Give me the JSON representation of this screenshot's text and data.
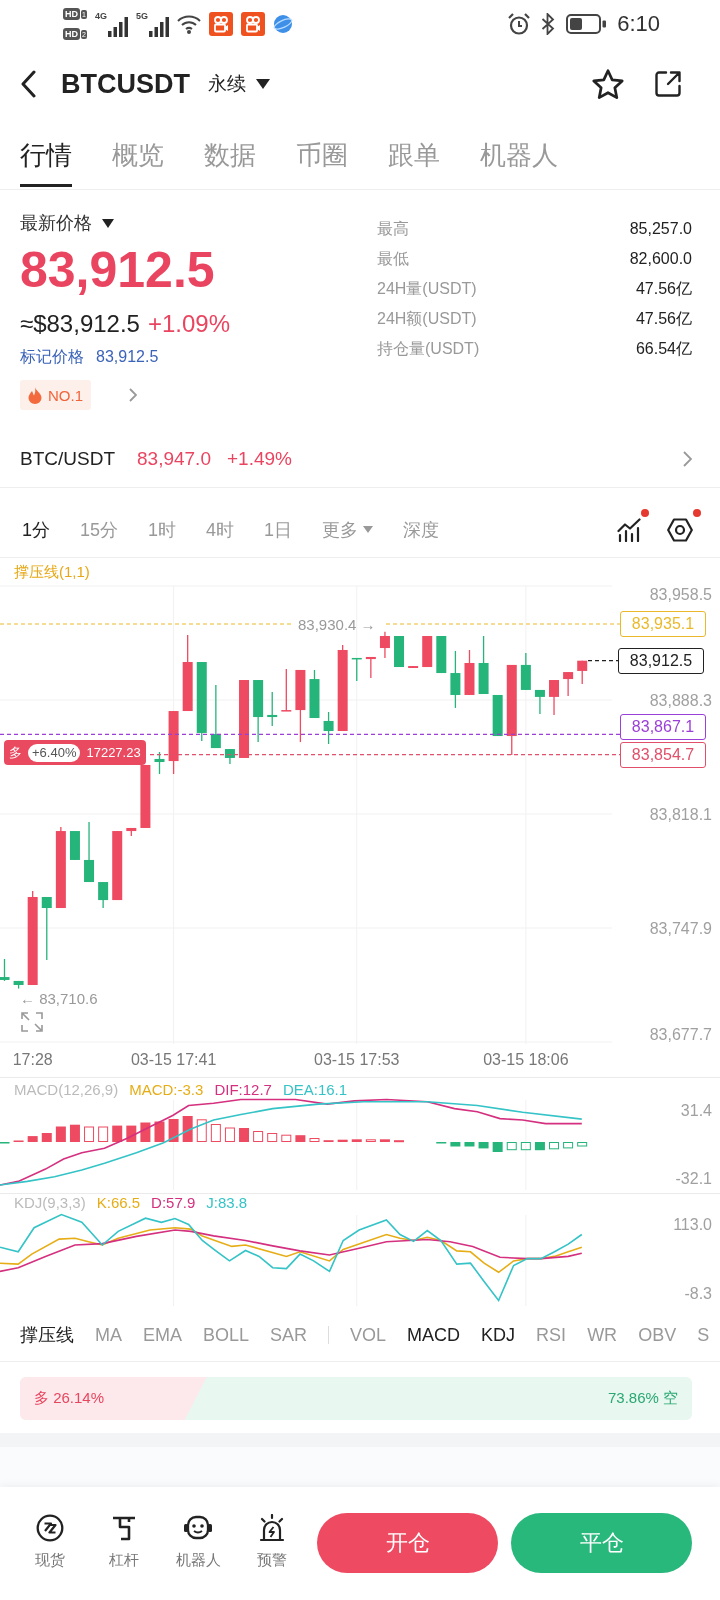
{
  "status_bar": {
    "sims": [
      {
        "badge": "HD",
        "slot": "1"
      },
      {
        "badge": "HD",
        "slot": "2"
      }
    ],
    "networks": [
      "4G",
      "5G"
    ],
    "time": "6:10"
  },
  "header": {
    "symbol": "BTCUSDT",
    "contract": "永续"
  },
  "tabs": [
    {
      "label": "行情",
      "selected": true
    },
    {
      "label": "概览",
      "selected": false
    },
    {
      "label": "数据",
      "selected": false
    },
    {
      "label": "币圈",
      "selected": false
    },
    {
      "label": "跟单",
      "selected": false
    },
    {
      "label": "机器人",
      "selected": false
    }
  ],
  "price": {
    "label": "最新价格",
    "last": "83,912.5",
    "usd": "≈$83,912.5",
    "change": "+1.09%",
    "mark_label": "标记价格",
    "mark": "83,912.5",
    "rank": "NO.1"
  },
  "stats": [
    {
      "label": "最高",
      "value": "85,257.0"
    },
    {
      "label": "最低",
      "value": "82,600.0"
    },
    {
      "label": "24H量(USDT)",
      "value": "47.56亿"
    },
    {
      "label": "24H额(USDT)",
      "value": "47.56亿"
    },
    {
      "label": "持仓量(USDT)",
      "value": "66.54亿"
    }
  ],
  "spot": {
    "pair": "BTC/USDT",
    "price": "83,947.0",
    "change": "+1.49%"
  },
  "timeframes": [
    {
      "label": "1分",
      "kind": "tab",
      "selected": true
    },
    {
      "label": "15分",
      "kind": "tab",
      "selected": false
    },
    {
      "label": "1时",
      "kind": "tab",
      "selected": false
    },
    {
      "label": "4时",
      "kind": "tab",
      "selected": false
    },
    {
      "label": "1日",
      "kind": "tab",
      "selected": false
    },
    {
      "label": "更多",
      "kind": "dropdown",
      "selected": false
    },
    {
      "label": "深度",
      "kind": "tab",
      "selected": false
    }
  ],
  "chart_tools": [
    {
      "kind": "indicators",
      "notice": true
    },
    {
      "kind": "settings",
      "notice": true
    }
  ],
  "chart": {
    "overlay": "撑压线(1,1)",
    "chart_data": {
      "type": "candlestick",
      "categories": [
        null,
        null,
        "17:28",
        null,
        null,
        null,
        null,
        null,
        null,
        null,
        null,
        null,
        "03-15 17:41",
        null,
        null,
        null,
        null,
        null,
        null,
        null,
        null,
        null,
        null,
        null,
        null,
        "03-15 17:53",
        null,
        null,
        null,
        null,
        null,
        null,
        null,
        null,
        null,
        null,
        null,
        "03-15 18:06",
        null,
        null,
        null,
        null
      ],
      "ohlc": [
        [
          83717.7,
          83728.8,
          83715.3,
          83715.9
        ],
        [
          83715.3,
          83715.3,
          83710.6,
          83712.8
        ],
        [
          83712.8,
          83770.7,
          83712.8,
          83767.0
        ],
        [
          83767.0,
          83767.0,
          83728.2,
          83760.2
        ],
        [
          83760.2,
          83810.1,
          83760.2,
          83807.6
        ],
        [
          83807.6,
          83807.6,
          83789.8,
          83789.8
        ],
        [
          83789.8,
          83813.2,
          83776.2,
          83776.2
        ],
        [
          83776.2,
          83776.2,
          83760.2,
          83765.1
        ],
        [
          83765.1,
          83807.6,
          83765.1,
          83807.6
        ],
        [
          83807.6,
          83809.5,
          83804.6,
          83809.5
        ],
        [
          83809.5,
          83848.3,
          83809.5,
          83848.3
        ],
        [
          83852.0,
          83856.3,
          83842.7,
          83850.1
        ],
        [
          83850.7,
          83881.5,
          83842.7,
          83881.5
        ],
        [
          83881.5,
          83928.3,
          83881.5,
          83911.7
        ],
        [
          83911.7,
          83911.7,
          83863.1,
          83868.0
        ],
        [
          83867.4,
          83897.5,
          83858.7,
          83858.7
        ],
        [
          83858.1,
          83858.1,
          83848.9,
          83852.6
        ],
        [
          83852.6,
          83900.6,
          83852.6,
          83900.6
        ],
        [
          83900.6,
          83900.6,
          83862.4,
          83877.8
        ],
        [
          83879.1,
          83893.2,
          83872.3,
          83877.8
        ],
        [
          83881.5,
          83907.4,
          83881.5,
          83882.1
        ],
        [
          83882.1,
          83906.8,
          83862.4,
          83906.8
        ],
        [
          83901.2,
          83906.8,
          83877.2,
          83877.2
        ],
        [
          83875.4,
          83880.9,
          83861.2,
          83869.2
        ],
        [
          83869.2,
          83922.2,
          83869.2,
          83919.1
        ],
        [
          83914.2,
          83914.2,
          83900.0,
          83913.5
        ],
        [
          83913.5,
          83914.8,
          83901.9,
          83914.8
        ],
        [
          83920.3,
          83930.4,
          83914.2,
          83927.7
        ],
        [
          83927.7,
          83927.7,
          83908.6,
          83908.6
        ],
        [
          83908.0,
          83909.2,
          83908.0,
          83909.2
        ],
        [
          83908.6,
          83927.7,
          83908.6,
          83927.7
        ],
        [
          83927.7,
          83927.7,
          83904.9,
          83904.9
        ],
        [
          83904.9,
          83918.5,
          83883.4,
          83891.4
        ],
        [
          83891.4,
          83919.1,
          83891.4,
          83911.1
        ],
        [
          83911.1,
          83927.7,
          83892.0,
          83892.0
        ],
        [
          83891.4,
          83891.4,
          83866.1,
          83866.1
        ],
        [
          83866.1,
          83909.9,
          83854.4,
          83909.9
        ],
        [
          83909.9,
          83917.2,
          83894.5,
          83894.5
        ],
        [
          83894.5,
          83894.5,
          83879.7,
          83890.2
        ],
        [
          83890.2,
          83900.6,
          83879.1,
          83900.6
        ],
        [
          83901.2,
          83905.5,
          83890.8,
          83905.5
        ],
        [
          83906.2,
          83912.5,
          83898.2,
          83912.5
        ]
      ],
      "ylim": [
        83677.7,
        83958.5
      ],
      "yticks": [
        {
          "value": 83958.5,
          "label": "83,958.5"
        },
        {
          "value": 83888.3,
          "label": "83,888.3"
        },
        {
          "value": 83818.1,
          "label": "83,818.1"
        },
        {
          "value": 83747.9,
          "label": "83,747.9"
        },
        {
          "value": 83677.7,
          "label": "83,677.7"
        }
      ],
      "grid": true,
      "ref_lines": [
        {
          "axis": "y",
          "value": 83935.1,
          "label": "83,935.1",
          "color": "#eab92b"
        },
        {
          "axis": "y",
          "value": 83867.1,
          "label": "83,867.1",
          "color": "#9b3fd8"
        },
        {
          "axis": "y",
          "value": 83854.7,
          "label": "83,854.7",
          "color": "#e0506a"
        }
      ]
    },
    "last_price": "83,912.5",
    "high_marker": "83,930.4 →",
    "low_marker": "← 83,710.6",
    "position": {
      "side": "多",
      "pnl": "+6.40%",
      "size": "17227.23"
    }
  },
  "macd": {
    "title": "MACD(12,26,9)",
    "values": [
      {
        "label": "MACD:-3.3",
        "color": "#e6ad17"
      },
      {
        "label": "DIF:12.7",
        "color": "#d4307f"
      },
      {
        "label": "DEA:16.1",
        "color": "#34c3c7"
      }
    ],
    "axis": [
      "31.4",
      "-32.1"
    ]
  },
  "kdj": {
    "title": "KDJ(9,3,3)",
    "values": [
      {
        "label": "K:66.5",
        "color": "#e6ad17"
      },
      {
        "label": "D:57.9",
        "color": "#d4307f"
      },
      {
        "label": "J:83.8",
        "color": "#34c3c7"
      }
    ],
    "axis": [
      "113.0",
      "-8.3"
    ]
  },
  "indicators": {
    "main": [
      {
        "label": "撑压线",
        "selected": true
      },
      {
        "label": "MA",
        "selected": false
      },
      {
        "label": "EMA",
        "selected": false
      },
      {
        "label": "BOLL",
        "selected": false
      },
      {
        "label": "SAR",
        "selected": false
      }
    ],
    "sub": [
      {
        "label": "VOL",
        "selected": false
      },
      {
        "label": "MACD",
        "selected": true
      },
      {
        "label": "KDJ",
        "selected": true
      },
      {
        "label": "RSI",
        "selected": false
      },
      {
        "label": "WR",
        "selected": false
      },
      {
        "label": "OBV",
        "selected": false
      },
      {
        "label": "S",
        "selected": false
      }
    ]
  },
  "sentiment": {
    "long": "多 26.14%",
    "short": "73.86% 空",
    "level": 0.2614
  },
  "bottom_nav": [
    {
      "label": "现货",
      "kind": "spot"
    },
    {
      "label": "杠杆",
      "kind": "margin"
    },
    {
      "label": "机器人",
      "kind": "robot"
    },
    {
      "label": "预警",
      "kind": "alert"
    }
  ],
  "actions": [
    {
      "label": "开仓",
      "kind": "open"
    },
    {
      "label": "平仓",
      "kind": "close"
    }
  ]
}
